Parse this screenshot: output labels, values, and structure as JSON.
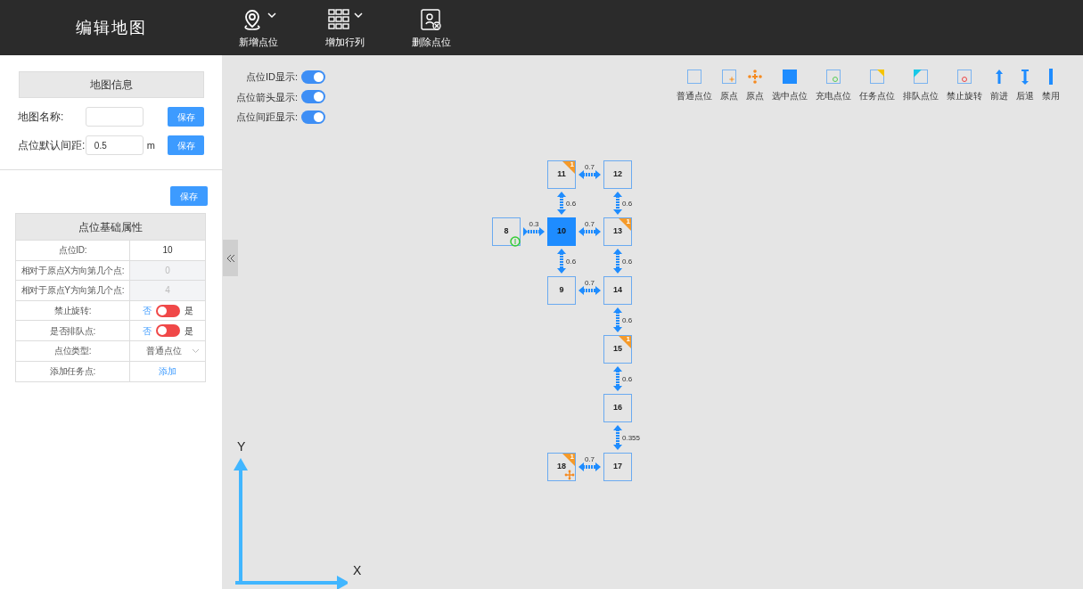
{
  "header": {
    "title": "编辑地图",
    "tools": [
      {
        "label": "新增点位",
        "kind": "pin",
        "dropdown": true
      },
      {
        "label": "增加行列",
        "kind": "grid",
        "dropdown": true
      },
      {
        "label": "删除点位",
        "kind": "delete",
        "dropdown": false
      }
    ]
  },
  "map_info": {
    "title": "地图信息",
    "fields": [
      {
        "label": "地图名称:",
        "button": "保存"
      },
      {
        "label": "点位默认间距:",
        "value": "0.5",
        "unit": "m",
        "button": "保存"
      }
    ]
  },
  "point_panel": {
    "button": "保存",
    "title": "点位基础属性",
    "rows": [
      {
        "label": "点位ID:",
        "kind": "text",
        "value": "10"
      },
      {
        "label": "相对于原点X方向第几个点:",
        "kind": "disabled",
        "value": "0"
      },
      {
        "label": "相对于原点Y方向第几个点:",
        "kind": "disabled",
        "value": "4"
      },
      {
        "label": "禁止旋转:",
        "kind": "toggle",
        "off_label": "否",
        "on_label": "是",
        "on": false
      },
      {
        "label": "是否排队点:",
        "kind": "toggle",
        "off_label": "否",
        "on_label": "是",
        "on": false
      },
      {
        "label": "点位类型:",
        "kind": "select",
        "value": "普通点位"
      },
      {
        "label": "添加任务点:",
        "kind": "link",
        "value": "添加"
      }
    ]
  },
  "display_toggles": [
    {
      "label": "点位ID显示:",
      "on": true
    },
    {
      "label": "点位箭头显示:",
      "on": true
    },
    {
      "label": "点位间距显示:",
      "on": true
    }
  ],
  "legend": [
    {
      "label": "普通点位",
      "kind": "normal"
    },
    {
      "label": "原点",
      "kind": "origin-box"
    },
    {
      "label": "原点",
      "kind": "origin"
    },
    {
      "label": "选中点位",
      "kind": "selected"
    },
    {
      "label": "充电点位",
      "kind": "charge"
    },
    {
      "label": "任务点位",
      "kind": "task"
    },
    {
      "label": "排队点位",
      "kind": "queue"
    },
    {
      "label": "禁止旋转",
      "kind": "norotate"
    },
    {
      "label": "前进",
      "kind": "forward"
    },
    {
      "label": "后退",
      "kind": "backward"
    },
    {
      "label": "禁用",
      "kind": "disabled"
    }
  ],
  "map": {
    "nodes": [
      {
        "label": "11",
        "kind": "normal",
        "badge": "1"
      },
      {
        "label": "12",
        "kind": "normal"
      },
      {
        "label": "8",
        "kind": "charge"
      },
      {
        "label": "10",
        "kind": "selected"
      },
      {
        "label": "13",
        "kind": "normal",
        "badge": "1"
      },
      {
        "label": "9",
        "kind": "normal"
      },
      {
        "label": "14",
        "kind": "normal"
      },
      {
        "label": "15",
        "kind": "normal",
        "badge": "1"
      },
      {
        "label": "16",
        "kind": "normal"
      },
      {
        "label": "18",
        "kind": "origin",
        "badge": "1"
      },
      {
        "label": "17",
        "kind": "normal"
      }
    ],
    "links": [
      {
        "label": "0.7",
        "kind": "both"
      },
      {
        "label": "0.6",
        "kind": "both"
      },
      {
        "label": "0.6",
        "kind": "both"
      },
      {
        "label": "0.3",
        "kind": "forward"
      },
      {
        "label": "0.7",
        "kind": "both"
      },
      {
        "label": "0.6",
        "kind": "both"
      },
      {
        "label": "0.6",
        "kind": "both"
      },
      {
        "label": "0.7",
        "kind": "both"
      },
      {
        "label": "0.6",
        "kind": "both"
      },
      {
        "label": "0.6",
        "kind": "both"
      },
      {
        "label": "0.355",
        "kind": "both"
      },
      {
        "label": "0.7",
        "kind": "both"
      }
    ],
    "axes": {
      "x": "X",
      "y": "Y"
    }
  }
}
